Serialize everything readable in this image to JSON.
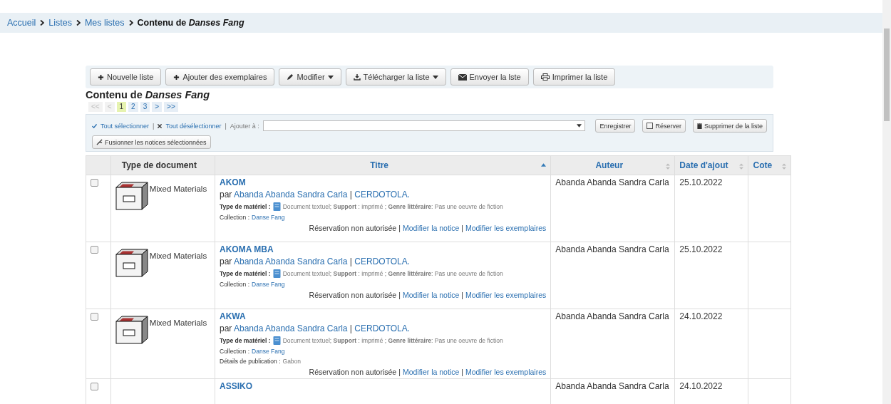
{
  "breadcrumb": {
    "links": [
      "Accueil",
      "Listes",
      "Mes listes"
    ],
    "current_prefix": "Contenu de",
    "current_name": "Danses Fang"
  },
  "toolbar": [
    {
      "label": "Nouvelle liste",
      "kind": "plus",
      "dropdown": false
    },
    {
      "label": "Ajouter des exemplaires",
      "kind": "plus",
      "dropdown": false
    },
    {
      "label": "Modifier",
      "kind": "pencil",
      "dropdown": true
    },
    {
      "label": "Télécharger la liste",
      "kind": "download",
      "dropdown": true
    },
    {
      "label": "Envoyer la lste",
      "kind": "mail",
      "dropdown": false
    },
    {
      "label": "Imprimer la liste",
      "kind": "print",
      "dropdown": false
    }
  ],
  "heading": {
    "prefix": "Contenu de",
    "name": "Danses Fang"
  },
  "pager": [
    {
      "label": "<<",
      "selected": false,
      "disabled": true
    },
    {
      "label": "<",
      "selected": false,
      "disabled": true
    },
    {
      "label": "1",
      "selected": true,
      "disabled": false
    },
    {
      "label": "2",
      "selected": false,
      "disabled": false
    },
    {
      "label": "3",
      "selected": false,
      "disabled": false
    },
    {
      "label": ">",
      "selected": false,
      "disabled": false
    },
    {
      "label": ">>",
      "selected": false,
      "disabled": false
    }
  ],
  "selection": {
    "select_all": "Tout sélectionner",
    "separator": "|",
    "deselect_all": "Tout désélectionner",
    "add_to": "Ajouter à :",
    "save": "Enregistrer",
    "reserve": "Réserver",
    "remove": "Supprimer de la liste",
    "merge": "Fusionner les notices sélectionnées"
  },
  "table": {
    "columns": [
      {
        "label": "Type de document",
        "sortable": false,
        "sorted": false
      },
      {
        "label": "Titre",
        "sortable": true,
        "sorted": true
      },
      {
        "label": "Auteur",
        "sortable": true,
        "sorted": false
      },
      {
        "label": "Date d'ajout",
        "sortable": true,
        "sorted": false
      },
      {
        "label": "Cote",
        "sortable": true,
        "sorted": false
      }
    ],
    "rows": [
      {
        "checked": false,
        "doc_type": "Mixed Materials",
        "title": "AKOM",
        "by": "par",
        "author": "Abanda Abanda Sandra Carla",
        "separator": "|",
        "publisher": "CERDOTOLA.",
        "material_label": "Type de matériel :",
        "material_text": "Document textuel; **Support** : imprimé ; **Genre littéraire**: Pas une oeuvre de fiction",
        "collection_label": "Collection :",
        "collection": "Danse Fang",
        "actions_note": "Réservation non autorisée",
        "action_separator": "|",
        "actions": [
          "Modifier la notice",
          "Modifier les exemplaires"
        ],
        "author_col": "Abanda Abanda Sandra Carla",
        "date": "25.10.2022"
      },
      {
        "checked": false,
        "doc_type": "Mixed Materials",
        "title": "AKOMA MBA",
        "by": "par",
        "author": "Abanda Abanda Sandra Carla",
        "separator": "|",
        "publisher": "CERDOTOLA.",
        "material_label": "Type de matériel :",
        "material_text": "Document textuel; **Support** : imprimé ; **Genre littéraire**: Pas une oeuvre de fiction",
        "collection_label": "Collection :",
        "collection": "Danse Fang",
        "actions_note": "Réservation non autorisée",
        "action_separator": "|",
        "actions": [
          "Modifier la notice",
          "Modifier les exemplaires"
        ],
        "author_col": "Abanda Abanda Sandra Carla",
        "date": "25.10.2022"
      },
      {
        "checked": false,
        "doc_type": "Mixed Materials",
        "title": "AKWA",
        "by": "par",
        "author": "Abanda Abanda Sandra Carla",
        "separator": "|",
        "publisher": "CERDOTOLA.",
        "material_label": "Type de matériel :",
        "material_text": "Document textuel; **Support** : imprimé ; **Genre littéraire**: Pas une oeuvre de fiction",
        "collection_label": "Collection :",
        "collection": "Danse Fang",
        "publication_label": "Détails de publication :",
        "publication": "Gabon",
        "actions_note": "Réservation non autorisée",
        "action_separator": "|",
        "actions": [
          "Modifier la notice",
          "Modifier les exemplaires"
        ],
        "author_col": "Abanda Abanda Sandra Carla",
        "date": "24.10.2022"
      },
      {
        "checked": false,
        "title": "ASSIKO",
        "author_col": "Abanda Abanda Sandra Carla",
        "date": "24.10.2022"
      }
    ]
  }
}
